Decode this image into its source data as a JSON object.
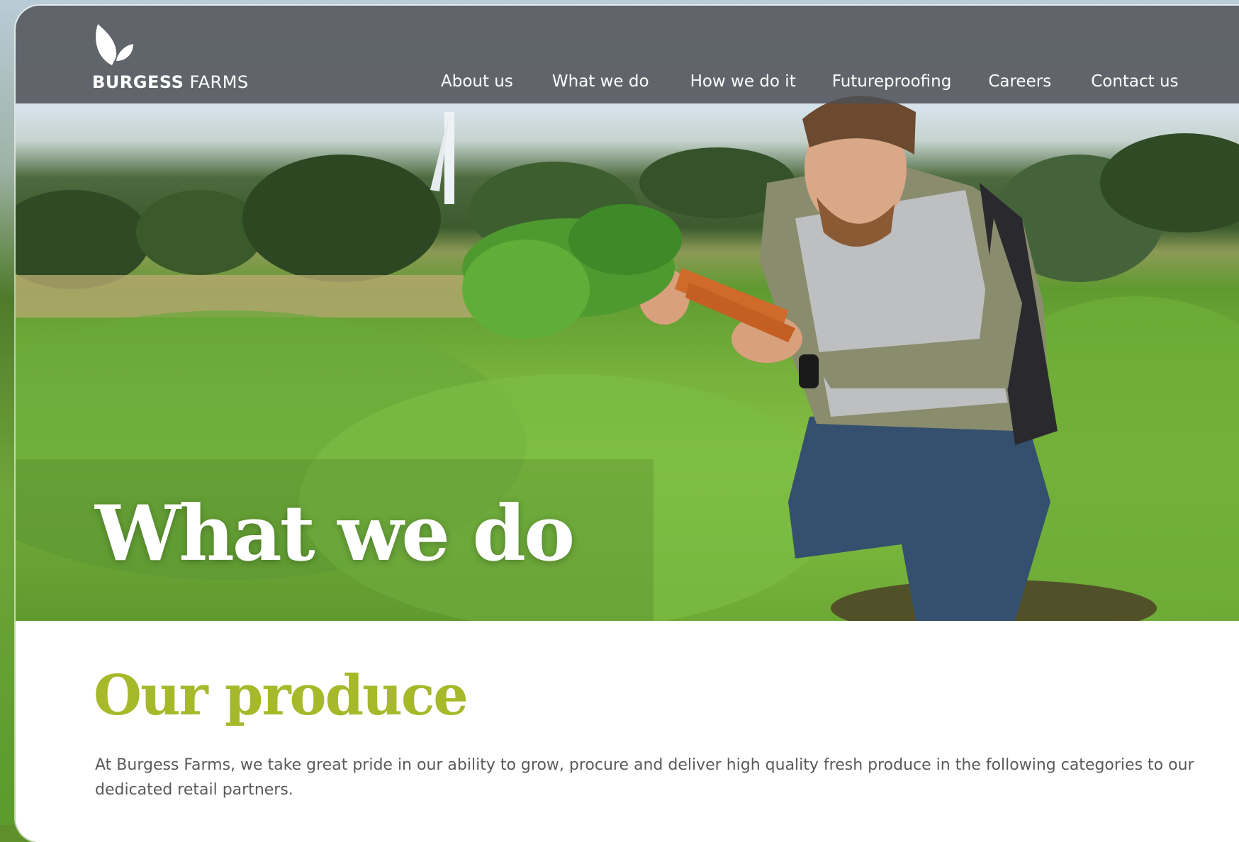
{
  "brand": {
    "name_bold": "BURGESS",
    "name_light": "FARMS"
  },
  "nav": {
    "items": [
      {
        "label": "About us"
      },
      {
        "label": "What we do"
      },
      {
        "label": "How we do it"
      },
      {
        "label": "Futureproofing"
      },
      {
        "label": "Careers"
      },
      {
        "label": "Contact us"
      }
    ]
  },
  "hero": {
    "title": "What we do"
  },
  "produce": {
    "title": "Our produce",
    "text": "At Burgess Farms, we take great pride in our ability to grow, procure and deliver high quality fresh produce in the following categories to our dedicated retail partners."
  },
  "colors": {
    "accent": "#a6b92a",
    "nav_bg": "#4e5056",
    "text": "#5a5a5a"
  }
}
